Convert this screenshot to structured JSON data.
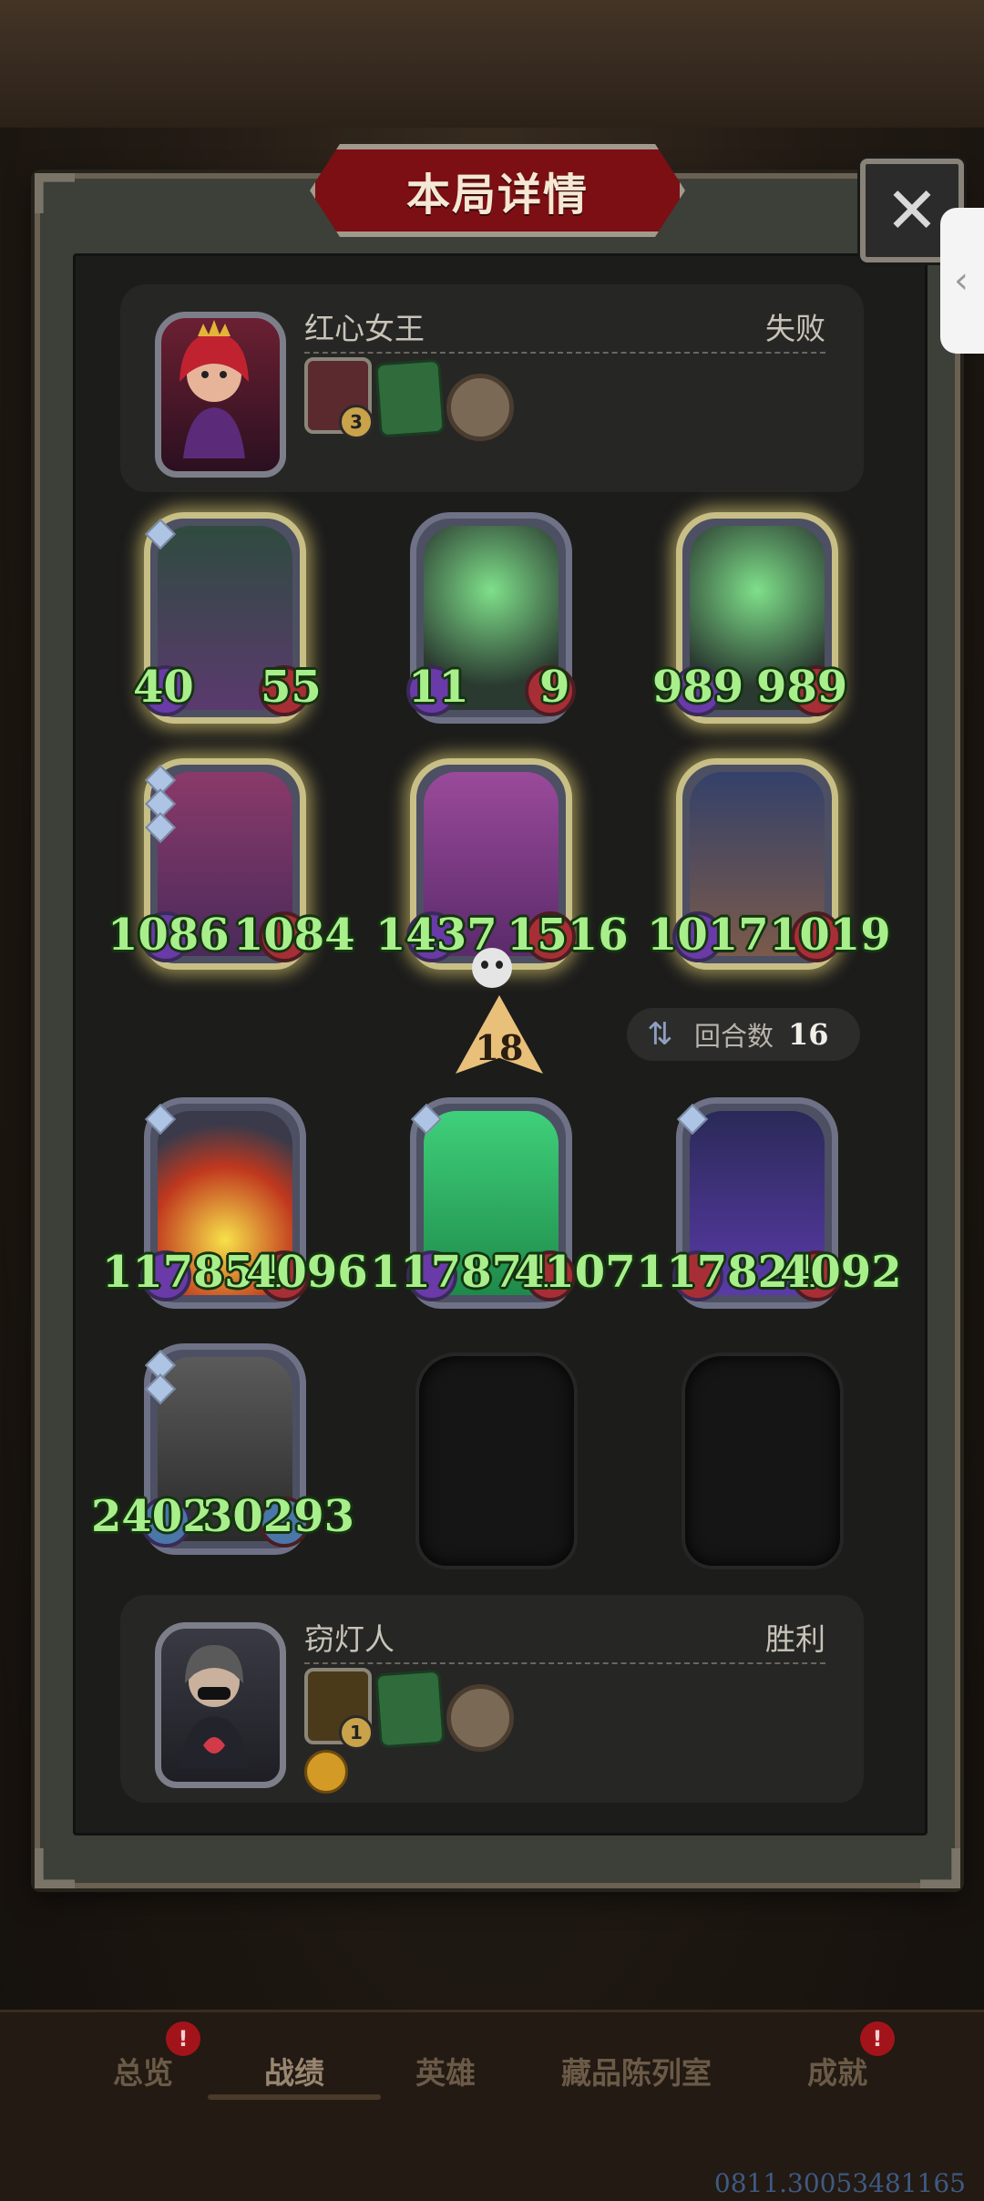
{
  "title": "本局详情",
  "close_label": "✕",
  "side_tab_icon": "‹",
  "opponent": {
    "name": "红心女王",
    "result": "失败",
    "hero_level": "3"
  },
  "player": {
    "name": "窃灯人",
    "result": "胜利",
    "hero_level": "1"
  },
  "opponent_units": [
    {
      "attack": "40",
      "health": "55"
    },
    {
      "attack": "11",
      "health": "9"
    },
    {
      "attack": "989",
      "health": "989"
    },
    {
      "attack": "1086",
      "health": "1084"
    },
    {
      "attack": "1437",
      "health": "1516"
    },
    {
      "attack": "1017",
      "health": "1019"
    }
  ],
  "damage": "18",
  "rounds": {
    "label": "回合数",
    "value": "16"
  },
  "player_units": [
    {
      "attack": "117851",
      "health": "4096"
    },
    {
      "attack": "117871",
      "health": "4107"
    },
    {
      "attack": "117821",
      "health": "4092"
    },
    {
      "attack": "2402",
      "health": "30293"
    }
  ],
  "nav": {
    "tabs": [
      "总览",
      "战绩",
      "英雄",
      "藏品陈列室",
      "成就"
    ],
    "alert": "!"
  },
  "watermark": "0811.30053481165"
}
